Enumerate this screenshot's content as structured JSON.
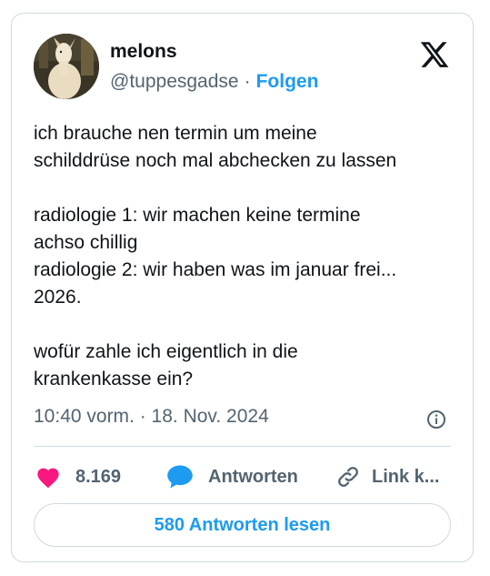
{
  "user": {
    "name": "melons",
    "handle": "@tuppesgadse",
    "separator": "·",
    "follow_label": "Folgen"
  },
  "tweet": {
    "lines": [
      "ich brauche nen termin um meine",
      "schilddrüse noch mal abchecken zu lassen",
      "",
      "radiologie 1: wir machen keine termine",
      "achso chillig",
      "radiologie 2: wir haben was im januar frei...",
      "2026.",
      "",
      "wofür zahle ich eigentlich in die",
      "krankenkasse ein?"
    ],
    "timestamp": "10:40 vorm. · 18. Nov. 2024"
  },
  "actions": {
    "like_count": "8.169",
    "reply_label": "Antworten",
    "link_label": "Link k..."
  },
  "read_replies_label": "580 Antworten lesen",
  "icons": {
    "like": "heart-icon",
    "reply": "speech-bubble-icon",
    "link": "link-icon",
    "info": "info-icon",
    "brand": "x-logo-icon"
  },
  "colors": {
    "like": "#f91880",
    "reply": "#1d9bf0",
    "accent": "#1d9bf0",
    "secondary_text": "#536471"
  }
}
